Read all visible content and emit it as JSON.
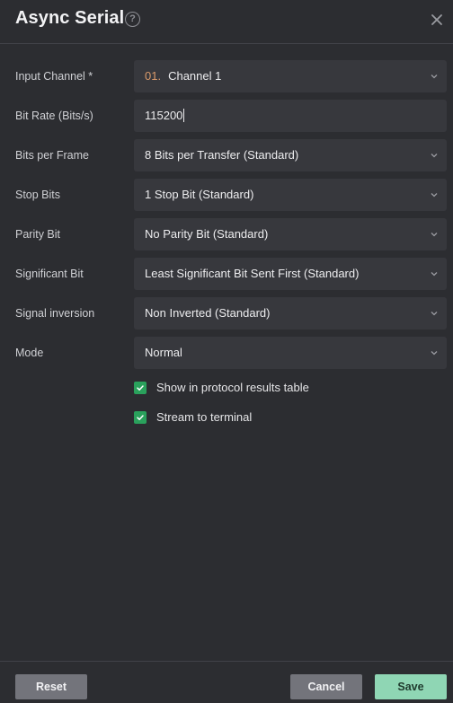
{
  "dialog": {
    "title": "Async Serial",
    "help_icon": "question-circle-icon",
    "help_glyph": "?",
    "close_icon": "close-icon"
  },
  "fields": [
    {
      "label": "Input Channel *",
      "prefix": "01.",
      "value": "Channel 1",
      "type": "select"
    },
    {
      "label": "Bit Rate (Bits/s)",
      "value": "115200",
      "type": "input"
    },
    {
      "label": "Bits per Frame",
      "value": "8 Bits per Transfer (Standard)",
      "type": "select"
    },
    {
      "label": "Stop Bits",
      "value": "1 Stop Bit (Standard)",
      "type": "select"
    },
    {
      "label": "Parity Bit",
      "value": "No Parity Bit (Standard)",
      "type": "select"
    },
    {
      "label": "Significant Bit",
      "value": "Least Significant Bit Sent First (Standard)",
      "type": "select"
    },
    {
      "label": "Signal inversion",
      "value": "Non Inverted (Standard)",
      "type": "select"
    },
    {
      "label": "Mode",
      "value": "Normal",
      "type": "select"
    }
  ],
  "checkboxes": [
    {
      "label": "Show in protocol results table",
      "checked": true
    },
    {
      "label": "Stream to terminal",
      "checked": true
    }
  ],
  "footer": {
    "reset_label": "Reset",
    "cancel_label": "Cancel",
    "save_label": "Save"
  },
  "colors": {
    "background": "#2c2d31",
    "field_background": "#37383d",
    "checkbox": "#2aa15c",
    "save_button": "#8fd6b4",
    "secondary_button": "#73747b",
    "channel_prefix": "#d99a6b"
  }
}
